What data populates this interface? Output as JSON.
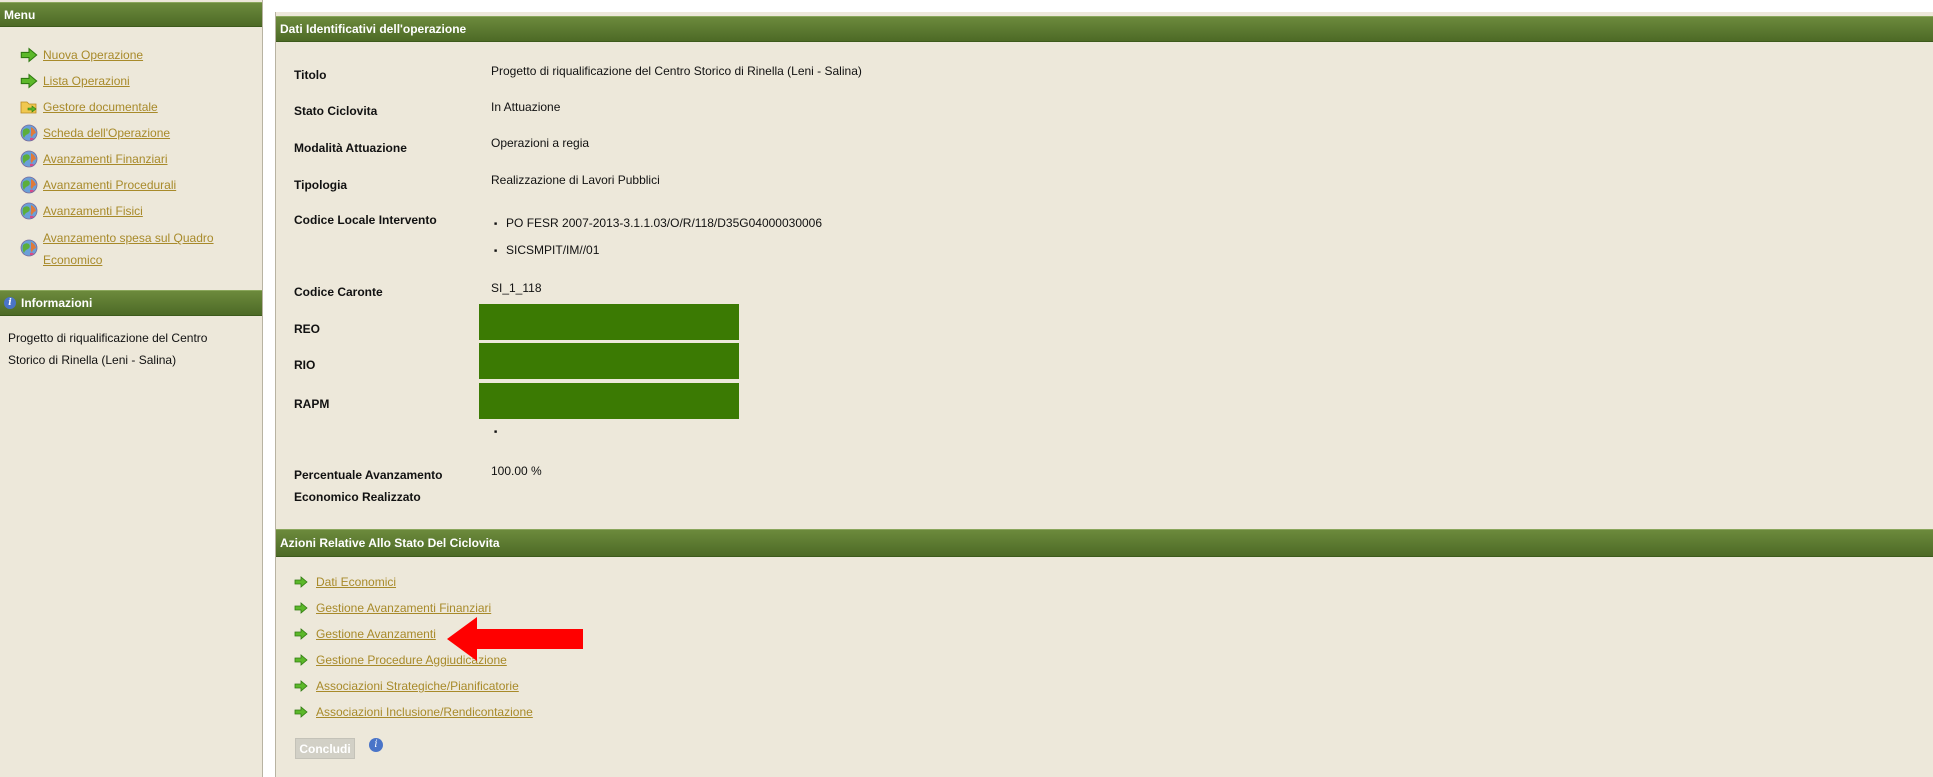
{
  "sidebar": {
    "menu_title": "Menu",
    "items": [
      {
        "label": "Nuova Operazione",
        "icon": "green-arrow-icon"
      },
      {
        "label": "Lista Operazioni",
        "icon": "green-arrow-icon"
      },
      {
        "label": "Gestore documentale",
        "icon": "folder-arrow-icon"
      },
      {
        "label": "Scheda dell'Operazione",
        "icon": "globe-icon"
      },
      {
        "label": "Avanzamenti Finanziari",
        "icon": "globe-icon"
      },
      {
        "label": "Avanzamenti Procedurali",
        "icon": "globe-icon"
      },
      {
        "label": "Avanzamenti Fisici",
        "icon": "globe-icon"
      },
      {
        "label": "Avanzamento spesa sul Quadro",
        "label2": "Economico",
        "icon": "globe-icon"
      }
    ],
    "info_title": "Informazioni",
    "info_text": "Progetto di riqualificazione del Centro Storico di Rinella (Leni - Salina)"
  },
  "dati": {
    "title": "Dati Identificativi dell'operazione",
    "titolo": {
      "label": "Titolo",
      "value": "Progetto di riqualificazione del Centro Storico di Rinella (Leni - Salina)"
    },
    "stato": {
      "label": "Stato Ciclovita",
      "value": "In Attuazione"
    },
    "modalita": {
      "label": "Modalità Attuazione",
      "value": "Operazioni a regia"
    },
    "tipologia": {
      "label": "Tipologia",
      "value": "Realizzazione di Lavori Pubblici"
    },
    "codice_locale": {
      "label": "Codice Locale Intervento",
      "values": [
        "PO FESR 2007-2013-3.1.1.03/O/R/118/D35G04000030006",
        "SICSMPIT/IM//01"
      ]
    },
    "codice_caronte": {
      "label": "Codice Caronte",
      "value": "SI_1_118"
    },
    "reo": {
      "label": "REO"
    },
    "rio": {
      "label": "RIO"
    },
    "rapm": {
      "label": "RAPM"
    },
    "percentuale": {
      "label_line1": "Percentuale Avanzamento",
      "label_line2": "Economico Realizzato",
      "value": "100.00 %"
    }
  },
  "azioni": {
    "title": "Azioni Relative Allo Stato Del Ciclovita",
    "items": [
      "Dati Economici",
      "Gestione Avanzamenti Finanziari",
      "Gestione Avanzamenti",
      "Gestione Procedure Aggiudicazione",
      "Associazioni Strategiche/Pianificatorie",
      "Associazioni Inclusione/Rendicontazione"
    ],
    "concludi": "Concludi"
  },
  "colors": {
    "header_green": "#5a7a2e",
    "link": "#a88a2a",
    "redact": "#3b7a03",
    "arrow": "#ff0000",
    "background": "#ede8da"
  }
}
